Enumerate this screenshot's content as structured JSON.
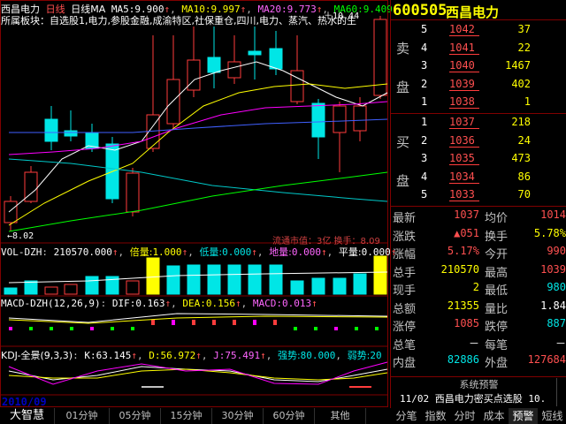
{
  "header": {
    "stock_name": "西昌电力",
    "period": "日线",
    "ma_label": "日线MA",
    "ma5_label": "MA5:",
    "ma5": "9.900",
    "ma10_label": "MA10:",
    "ma10": "9.997",
    "ma20_label": "MA20:",
    "ma20": "9.773",
    "ma60_label": "MA60:",
    "ma60": "9.409",
    "peak_price": "10.44"
  },
  "sector_line": "所属板块：自选股1,电力,参股金融,成渝特区,社保重仓,四川,电力、蒸汽、热水的生",
  "low_price": "8.02",
  "overlay_text": "流通市值：3亿 换手：8.09",
  "vol": {
    "label": "VOL-DZH",
    "value": "210570.000",
    "bei_label": "倍量:",
    "bei": "1.000",
    "di_label": "低量:",
    "di": "0.000",
    "dil_label": "地量:",
    "dil": "0.000",
    "ping_label": "平量:",
    "ping": "0.000"
  },
  "macd": {
    "label": "MACD-DZH(12,26,9)",
    "dif_label": "DIF:",
    "dif": "0.163",
    "dea_label": "DEA:",
    "dea": "0.156",
    "macd_label": "MACD:",
    "macd": "0.013"
  },
  "kdj": {
    "label": "KDJ-全景(9,3,3)",
    "k_label": "K:",
    "k": "63.145",
    "d_label": "D:",
    "d": "56.972",
    "j_label": "J:",
    "j": "75.491",
    "qs_label": "强势:",
    "qs": "80.000",
    "rs_label": "弱势:",
    "rs": "20"
  },
  "date_label": "2010/09",
  "bottom_tabs": [
    "大智慧",
    "01分钟",
    "05分钟",
    "15分钟",
    "30分钟",
    "60分钟",
    "其他"
  ],
  "quote": {
    "code": "600505",
    "name": "西昌电力",
    "sell_label": [
      "卖",
      "盘"
    ],
    "buy_label": [
      "买",
      "盘"
    ],
    "sells": [
      {
        "lv": "5",
        "price": "1042",
        "vol": "37"
      },
      {
        "lv": "4",
        "price": "1041",
        "vol": "22"
      },
      {
        "lv": "3",
        "price": "1040",
        "vol": "1467"
      },
      {
        "lv": "2",
        "price": "1039",
        "vol": "402"
      },
      {
        "lv": "1",
        "price": "1038",
        "vol": "1"
      }
    ],
    "buys": [
      {
        "lv": "1",
        "price": "1037",
        "vol": "218"
      },
      {
        "lv": "2",
        "price": "1036",
        "vol": "24"
      },
      {
        "lv": "3",
        "price": "1035",
        "vol": "473"
      },
      {
        "lv": "4",
        "price": "1034",
        "vol": "86"
      },
      {
        "lv": "5",
        "price": "1033",
        "vol": "70"
      }
    ],
    "stats": [
      {
        "l1": "最新",
        "v1": "1037",
        "c1": "vr",
        "l2": "均价",
        "v2": "1014",
        "c2": "vr"
      },
      {
        "l1": "涨跌",
        "v1": "▲051",
        "c1": "vr",
        "l2": "换手",
        "v2": "5.78%",
        "c2": "vy"
      },
      {
        "l1": "涨幅",
        "v1": "5.17%",
        "c1": "vr",
        "l2": "今开",
        "v2": "990",
        "c2": "vr"
      },
      {
        "l1": "总手",
        "v1": "210570",
        "c1": "vy",
        "l2": "最高",
        "v2": "1039",
        "c2": "vr"
      },
      {
        "l1": "现手",
        "v1": "2",
        "c1": "vy",
        "l2": "最低",
        "v2": "980",
        "c2": "vg"
      },
      {
        "l1": "总额",
        "v1": "21355",
        "c1": "vy",
        "l2": "量比",
        "v2": "1.84",
        "c2": "vw"
      },
      {
        "l1": "涨停",
        "v1": "1085",
        "c1": "vr",
        "l2": "跌停",
        "v2": "887",
        "c2": "vg"
      },
      {
        "l1": "总笔",
        "v1": "－",
        "c1": "vw",
        "l2": "每笔",
        "v2": "－",
        "c2": "vw"
      },
      {
        "l1": "内盘",
        "v1": "82886",
        "c1": "vg",
        "l2": "外盘",
        "v2": "127684",
        "c2": "vr"
      }
    ],
    "alert_title": "系统预警",
    "alert_date": "11/02",
    "alert_text": "西昌电力密买点选股",
    "alert_num": "10."
  },
  "right_tabs": [
    "分笔",
    "指数",
    "分时",
    "成本",
    "预警",
    "短线"
  ],
  "colors": {
    "up": "#ff3c3c",
    "down": "#00e6e6",
    "bg": "#000000",
    "grid": "#800000",
    "yellow": "#ffff00",
    "magenta": "#ff00ff",
    "green": "#00ff00"
  }
}
